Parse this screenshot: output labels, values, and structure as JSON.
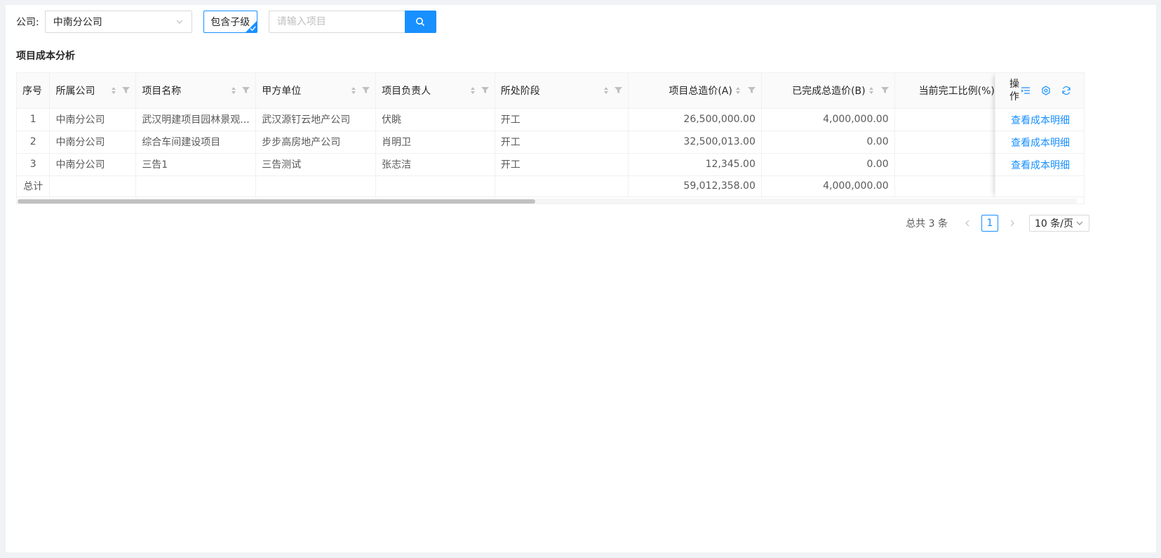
{
  "toolbar": {
    "company_label": "公司:",
    "company_value": "中南分公司",
    "include_sub_label": "包含子级",
    "search_placeholder": "请输入项目"
  },
  "section_title": "项目成本分析",
  "table": {
    "columns": [
      "序号",
      "所属公司",
      "项目名称",
      "甲方单位",
      "项目负责人",
      "所处阶段",
      "项目总造价(A)",
      "已完成总造价(B)",
      "当前完工比例(%)("
    ],
    "action_header": "操作",
    "rows": [
      {
        "index": "1",
        "company": "中南分公司",
        "project": "武汉明建项目园林景观...",
        "client": "武汉源钉云地产公司",
        "manager": "伏眺",
        "stage": "开工",
        "total": "26,500,000.00",
        "completed": "4,000,000.00",
        "ratio": "",
        "action": "查看成本明细"
      },
      {
        "index": "2",
        "company": "中南分公司",
        "project": "综合车间建设项目",
        "client": "步步高房地产公司",
        "manager": "肖明卫",
        "stage": "开工",
        "total": "32,500,013.00",
        "completed": "0.00",
        "ratio": "",
        "action": "查看成本明细"
      },
      {
        "index": "3",
        "company": "中南分公司",
        "project": "三告1",
        "client": "三告测试",
        "manager": "张志洁",
        "stage": "开工",
        "total": "12,345.00",
        "completed": "0.00",
        "ratio": "",
        "action": "查看成本明细"
      }
    ],
    "summary": {
      "label": "总计",
      "total": "59,012,358.00",
      "completed": "4,000,000.00"
    }
  },
  "pagination": {
    "total_text": "总共 3 条",
    "current_page": "1",
    "page_size": "10 条/页"
  },
  "colors": {
    "primary": "#1890ff",
    "header_bg": "#fafafa",
    "border": "#f0f0f0"
  },
  "icons": [
    "chevron-down-icon",
    "check-icon",
    "search-icon",
    "sort-icon",
    "filter-icon",
    "column-setting-icon",
    "settings-icon",
    "refresh-icon",
    "chevron-left-icon",
    "chevron-right-icon"
  ]
}
